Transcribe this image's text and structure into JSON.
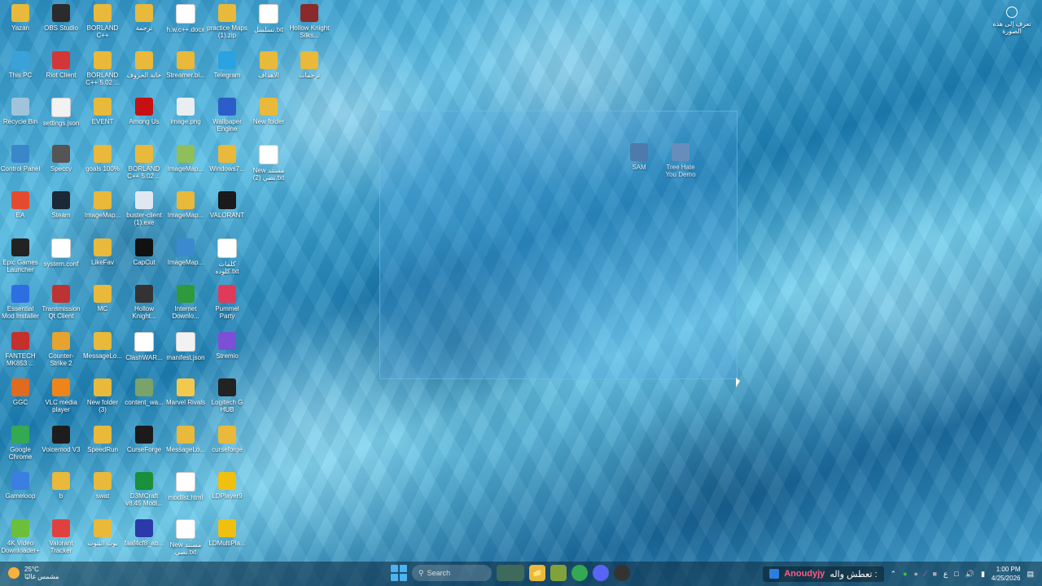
{
  "desktop": {
    "icons": [
      {
        "label": "Yazan",
        "icon": "folder-icon",
        "color": "#e8b93b"
      },
      {
        "label": "This PC",
        "icon": "computer-icon",
        "color": "#3aa2d8"
      },
      {
        "label": "Recycle Bin",
        "icon": "recycle-bin-icon",
        "color": "#9fc3d9"
      },
      {
        "label": "Control Panel",
        "icon": "control-panel-icon",
        "color": "#3a88c9"
      },
      {
        "label": "EA",
        "icon": "ea-icon",
        "color": "#e44b2e"
      },
      {
        "label": "Epic Games Launcher",
        "icon": "epic-games-icon",
        "color": "#222222"
      },
      {
        "label": "Essential Mod Installer",
        "icon": "essential-icon",
        "color": "#2d6fe0"
      },
      {
        "label": "FANTECH MK853 ...",
        "icon": "fantech-icon",
        "color": "#c4302b"
      },
      {
        "label": "GGC",
        "icon": "ggc-icon",
        "color": "#e06a20"
      },
      {
        "label": "Google Chrome",
        "icon": "chrome-icon",
        "color": "#34a853"
      },
      {
        "label": "Gameloop",
        "icon": "gameloop-icon",
        "color": "#3b7fe0"
      },
      {
        "label": "4K Video Downloader+",
        "icon": "4k-video-downloader-icon",
        "color": "#6bbf3a"
      },
      {
        "label": "OBS Studio",
        "icon": "obs-icon",
        "color": "#2b2b2b"
      },
      {
        "label": "Riot Client",
        "icon": "riot-icon",
        "color": "#d13639"
      },
      {
        "label": "settings.json",
        "icon": "json-file-icon",
        "color": "#f2f2f2"
      },
      {
        "label": "Speccy",
        "icon": "speccy-icon",
        "color": "#555555"
      },
      {
        "label": "Steam",
        "icon": "steam-icon",
        "color": "#1b2838"
      },
      {
        "label": "system.conf",
        "icon": "file-icon",
        "color": "#ffffff"
      },
      {
        "label": "Transmission Qt Client",
        "icon": "transmission-icon",
        "color": "#b33"
      },
      {
        "label": "Counter-Strike 2",
        "icon": "counter-strike-icon",
        "color": "#e6a32e"
      },
      {
        "label": "VLC media player",
        "icon": "vlc-icon",
        "color": "#f08418"
      },
      {
        "label": "Voicemod V3",
        "icon": "voicemod-icon",
        "color": "#1d1d1d"
      },
      {
        "label": "b",
        "icon": "folder-icon",
        "color": "#e8b93b"
      },
      {
        "label": "Valorant Tracker",
        "icon": "valorant-tracker-icon",
        "color": "#e0403e"
      },
      {
        "label": "BORLAND C++",
        "icon": "folder-icon",
        "color": "#e8b93b"
      },
      {
        "label": "BORLAND C++ 5.02 ...",
        "icon": "folder-icon",
        "color": "#e8b93b"
      },
      {
        "label": "EVENT",
        "icon": "folder-icon",
        "color": "#e8b93b"
      },
      {
        "label": "goals 100%",
        "icon": "folder-icon",
        "color": "#e8b93b"
      },
      {
        "label": "ImageMap...",
        "icon": "folder-icon",
        "color": "#e8b93b"
      },
      {
        "label": "LikeFav",
        "icon": "folder-icon",
        "color": "#e8b93b"
      },
      {
        "label": "MC",
        "icon": "folder-icon",
        "color": "#e8b93b"
      },
      {
        "label": "MessageLo...",
        "icon": "folder-icon",
        "color": "#e8b93b"
      },
      {
        "label": "New folder (3)",
        "icon": "folder-icon",
        "color": "#e8b93b"
      },
      {
        "label": "SpeedRun",
        "icon": "folder-icon",
        "color": "#e8b93b"
      },
      {
        "label": "swat",
        "icon": "folder-icon",
        "color": "#e8b93b"
      },
      {
        "label": "بوت البنوت",
        "icon": "folder-icon",
        "color": "#e8b93b"
      },
      {
        "label": "ترجمة",
        "icon": "folder-icon",
        "color": "#e8b93b"
      },
      {
        "label": "خانة الحروف",
        "icon": "folder-icon",
        "color": "#e8b93b"
      },
      {
        "label": "Among Us",
        "icon": "among-us-icon",
        "color": "#c51111"
      },
      {
        "label": "BORLAND C++ 5.02 ...",
        "icon": "folder-icon",
        "color": "#e8b93b"
      },
      {
        "label": "buster-client (1).exe",
        "icon": "exe-icon",
        "color": "#dfe8f0"
      },
      {
        "label": "CapCut",
        "icon": "capcut-icon",
        "color": "#111111"
      },
      {
        "label": "Hollow Knight...",
        "icon": "hollow-knight-icon",
        "color": "#333333"
      },
      {
        "label": "ClashWAR...",
        "icon": "file-icon",
        "color": "#ffffff"
      },
      {
        "label": "content_wa...",
        "icon": "image-icon",
        "color": "#7aa36b"
      },
      {
        "label": "CurseForge",
        "icon": "curseforge-icon",
        "color": "#1b1b1b"
      },
      {
        "label": "D3MCraft v8.45 Modi...",
        "icon": "d3mcraft-icon",
        "color": "#1a8f3c"
      },
      {
        "label": "faaf4cf8_ab...",
        "icon": "file-icon",
        "color": "#2b3aa8"
      },
      {
        "label": "h.w.c++.docx",
        "icon": "docx-icon",
        "color": "#ffffff"
      },
      {
        "label": "Streamer.bi...",
        "icon": "folder-icon",
        "color": "#e8b93b"
      },
      {
        "label": "image.png",
        "icon": "image-icon",
        "color": "#e9eef3"
      },
      {
        "label": "ImageMap...",
        "icon": "image-icon",
        "color": "#8fbf5a"
      },
      {
        "label": "ImageMap...",
        "icon": "folder-icon",
        "color": "#e8b93b"
      },
      {
        "label": "ImageMap...",
        "icon": "image-icon",
        "color": "#3b8ad0"
      },
      {
        "label": "Internet Downlo...",
        "icon": "idm-icon",
        "color": "#2e9a3b"
      },
      {
        "label": "manifest.json",
        "icon": "json-file-icon",
        "color": "#f2f2f2"
      },
      {
        "label": "Marvel Rivals",
        "icon": "marvel-rivals-icon",
        "color": "#f2c94c"
      },
      {
        "label": "MessageLo...",
        "icon": "folder-icon",
        "color": "#e8b93b"
      },
      {
        "label": "modlist.html",
        "icon": "html-file-icon",
        "color": "#ffffff"
      },
      {
        "label": "New مستند نصي.txt",
        "icon": "txt-file-icon",
        "color": "#ffffff"
      },
      {
        "label": "practice Maps (1).zip",
        "icon": "zip-folder-icon",
        "color": "#e8b93b"
      },
      {
        "label": "Telegram",
        "icon": "telegram-icon",
        "color": "#2aa3e0"
      },
      {
        "label": "Wallpaper Engine",
        "icon": "wallpaper-engine-icon",
        "color": "#2c5ec9"
      },
      {
        "label": "Windows7...",
        "icon": "folder-icon",
        "color": "#e8b93b"
      },
      {
        "label": "VALORANT",
        "icon": "valorant-icon",
        "color": "#1a1a1a"
      },
      {
        "label": "كلمات كلوده.txt",
        "icon": "txt-file-icon",
        "color": "#ffffff"
      },
      {
        "label": "Pummel Party",
        "icon": "pummel-party-icon",
        "color": "#e03a5a"
      },
      {
        "label": "Stremio",
        "icon": "stremio-icon",
        "color": "#7b4fd6"
      },
      {
        "label": "Logitech G HUB",
        "icon": "logitech-icon",
        "color": "#222222"
      },
      {
        "label": "curseforge",
        "icon": "folder-icon",
        "color": "#e8b93b"
      },
      {
        "label": "LDPlayer9",
        "icon": "ldplayer-icon",
        "color": "#f0c010"
      },
      {
        "label": "LDMultiPla...",
        "icon": "ldmultiplayer-icon",
        "color": "#f0c010"
      },
      {
        "label": "تسلسل.txt",
        "icon": "txt-file-icon",
        "color": "#ffffff"
      },
      {
        "label": "الاهداف",
        "icon": "folder-icon",
        "color": "#e8b93b"
      },
      {
        "label": "New folder",
        "icon": "folder-icon",
        "color": "#e8b93b"
      },
      {
        "label": "New مستند نصي (2).txt",
        "icon": "txt-file-icon",
        "color": "#ffffff"
      },
      {
        "label": "Hollow Knight Silks...",
        "icon": "hollow-knight-silksong-icon",
        "color": "#8a2a2a"
      },
      {
        "label": "ترجمات",
        "icon": "folder-icon",
        "color": "#e8b93b"
      }
    ],
    "selected_icons": [
      {
        "label": "SAM",
        "icon": "sam-icon",
        "color": "#4a6f9c"
      },
      {
        "label": "Tree Hate You Demo",
        "icon": "tree-hate-you-icon",
        "color": "#6a86b0"
      }
    ],
    "top_right": {
      "label": "تعرف إلى هذه الصورة",
      "icon": "camera-icon"
    }
  },
  "taskbar": {
    "weather_temp": "25°C",
    "weather_desc": "مشمس غالبًا",
    "search_placeholder": "Search",
    "now_playing_user": "Anoudyjy",
    "now_playing_text": "تعطش واله :",
    "lang": "ع",
    "time": "1:00 PM",
    "date": "4/25/2026"
  }
}
